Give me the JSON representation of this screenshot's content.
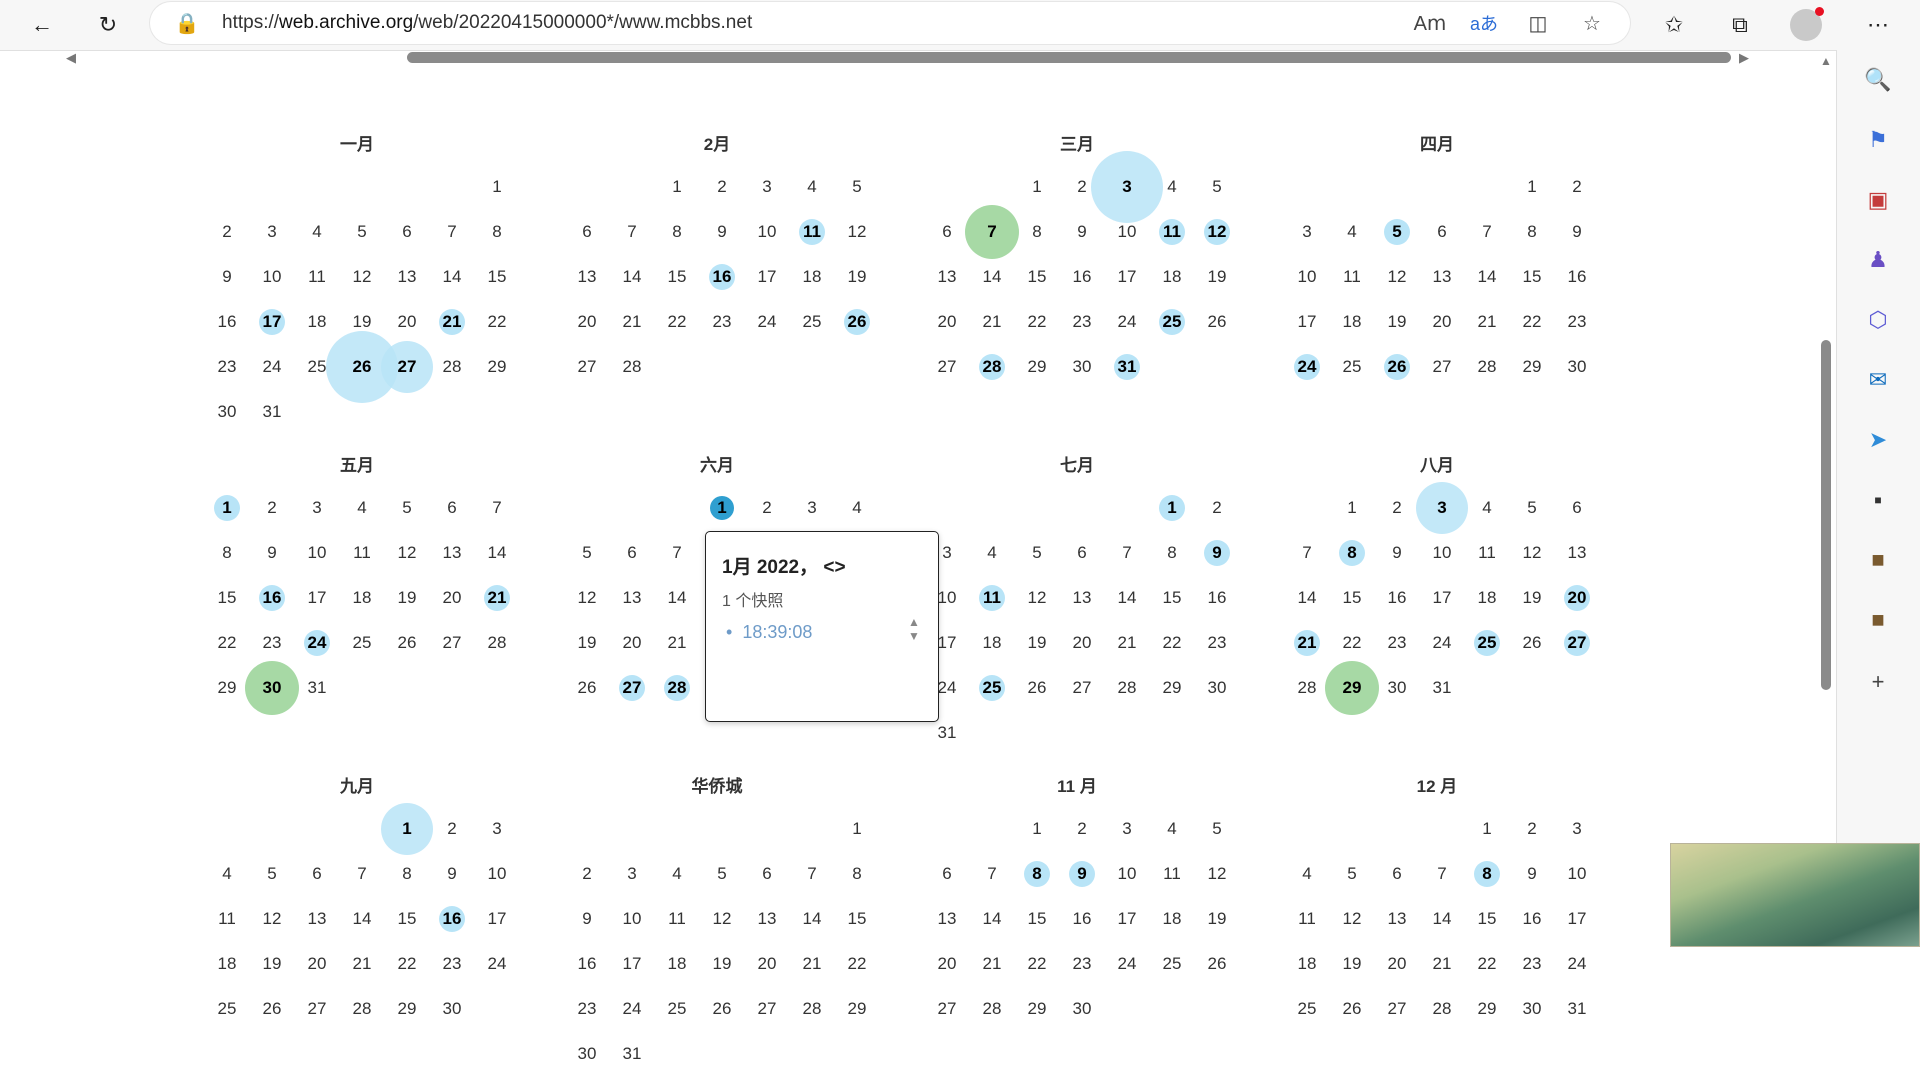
{
  "browser": {
    "url_prefix": "https://",
    "url_host": "web.archive.org",
    "url_rest": "/web/20220415000000*/www.mcbbs.net"
  },
  "icons": {
    "back": "arrow-left-icon",
    "refresh": "refresh-icon",
    "lock": "lock-icon",
    "read_aloud": "read-aloud-icon",
    "translate": "translate-icon",
    "split": "split-screen-icon",
    "favorite_add": "star-add-icon",
    "favorites": "favorites-icon",
    "collections": "collections-icon",
    "profile": "profile-icon",
    "more": "more-icon"
  },
  "sidebar_icons": [
    "search-icon",
    "tag-icon",
    "toolbox-icon",
    "games-icon",
    "office-icon",
    "outlook-icon",
    "send-icon",
    "mcbbs-icon",
    "minecraft-block-icon",
    "minecraft-chest-icon",
    "add-icon"
  ],
  "popup": {
    "title": "1月 2022， <>",
    "count": "1 个快照",
    "times": [
      "18:39:08"
    ]
  },
  "colors": {
    "snap_blue": "#b8e4f7",
    "snap_dark": "#2f9fd0",
    "snap_green": "#a7d9a5"
  },
  "months": [
    {
      "title": "一月",
      "days": 31,
      "start": 6,
      "snaps": {
        "17": "sm",
        "21": "sm",
        "26": "lg",
        "27": "md"
      }
    },
    {
      "title": "2月",
      "days": 28,
      "start": 2,
      "snaps": {
        "11": "sm",
        "16": "sm",
        "26": "sm"
      }
    },
    {
      "title": "三月",
      "days": 31,
      "start": 2,
      "snaps": {
        "3": "lg",
        "7": "green",
        "11": "sm",
        "12": "sm",
        "25": "sm",
        "28": "sm",
        "31": "sm"
      }
    },
    {
      "title": "四月",
      "days": 30,
      "start": 5,
      "snaps": {
        "5": "sm",
        "24": "sm",
        "26": "sm"
      }
    },
    {
      "title": "五月",
      "days": 31,
      "start": 0,
      "snaps": {
        "1": "sm",
        "16": "sm",
        "21": "sm",
        "24": "sm",
        "30": "green"
      }
    },
    {
      "title": "六月",
      "days": 30,
      "start": 3,
      "snaps": {
        "1": "dark",
        "27": "sm",
        "28": "sm"
      }
    },
    {
      "title": "七月",
      "days": 31,
      "start": 5,
      "snaps": {
        "1": "sm",
        "9": "sm",
        "11": "sm",
        "25": "sm"
      }
    },
    {
      "title": "八月",
      "days": 31,
      "start": 1,
      "snaps": {
        "3": "md",
        "8": "sm",
        "20": "sm",
        "21": "sm",
        "25": "sm",
        "27": "sm",
        "29": "green"
      }
    },
    {
      "title": "九月",
      "days": 30,
      "start": 4,
      "snaps": {
        "1": "md",
        "16": "sm"
      }
    },
    {
      "title": "华侨城",
      "days": 31,
      "start": 6,
      "snaps": {}
    },
    {
      "title": "11 月",
      "days": 30,
      "start": 2,
      "snaps": {
        "8": "sm",
        "9": "sm"
      }
    },
    {
      "title": "12 月",
      "days": 31,
      "start": 4,
      "snaps": {
        "8": "sm"
      }
    }
  ]
}
